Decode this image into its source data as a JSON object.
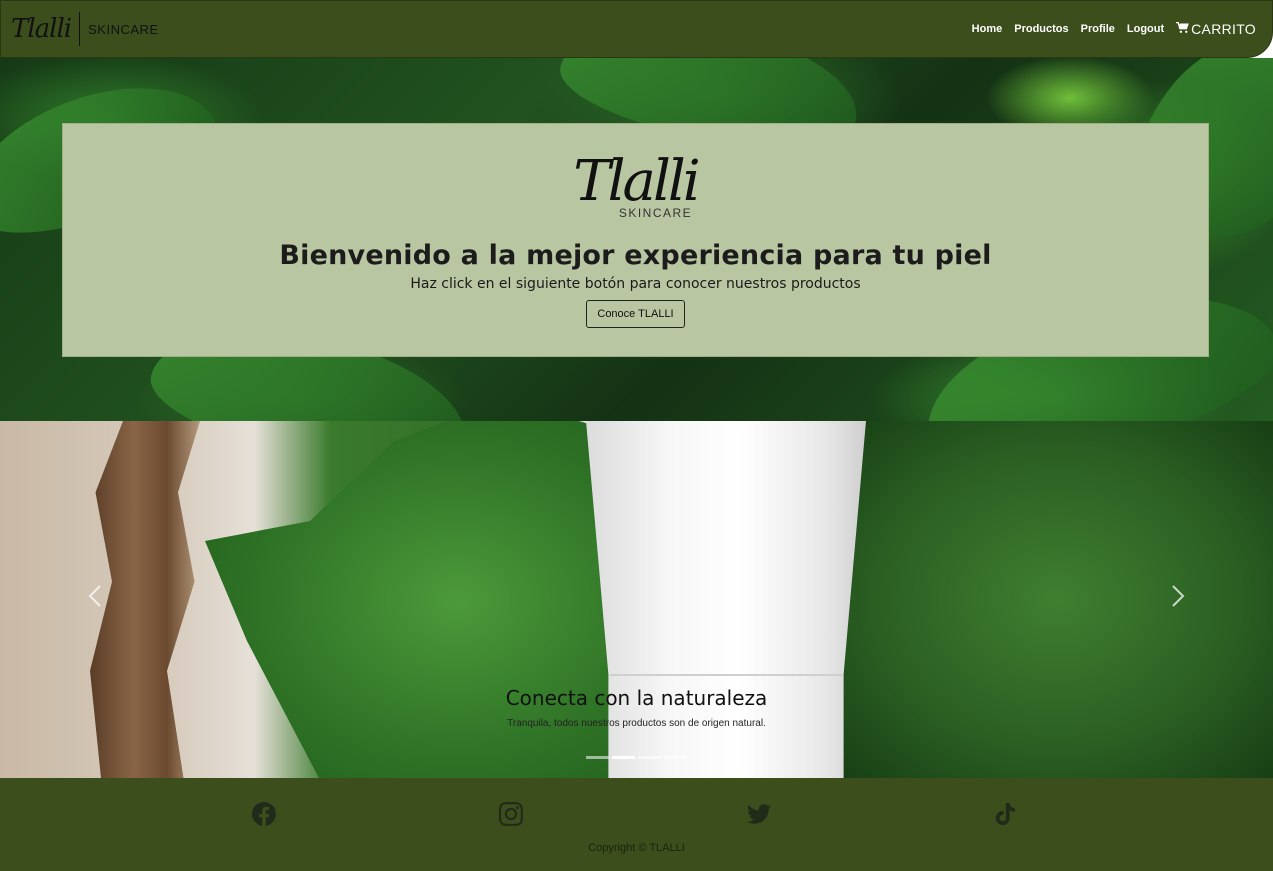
{
  "navbar": {
    "brand_script": "Tlalli",
    "brand_sub": "SKINCARE",
    "links": [
      "Home",
      "Productos",
      "Profile",
      "Logout"
    ],
    "cart_label": "CARRITO",
    "cart_icon": "cart-icon"
  },
  "hero": {
    "logo_script": "Tlalli",
    "logo_sub": "SKINCARE",
    "title": "Bienvenido a la mejor experiencia para tu piel",
    "subtitle": "Haz click en el siguiente botón para conocer nuestros productos",
    "button_label": "Conoce TLALLI"
  },
  "carousel": {
    "caption_title": "Conecta con la naturaleza",
    "caption_text": "Tranquila, todos nuestros productos son de origen natural.",
    "slide_count": 4,
    "active_index": 1,
    "prev_icon": "chevron-left-icon",
    "next_icon": "chevron-right-icon"
  },
  "footer": {
    "social": [
      "facebook-icon",
      "instagram-icon",
      "twitter-icon",
      "tiktok-icon"
    ],
    "copyright": "Copyright © TLALLI"
  },
  "colors": {
    "nav_bg": "#3c4e1c",
    "hero_card": "#b8c7a1",
    "footer_bg": "#3c4e1c"
  }
}
